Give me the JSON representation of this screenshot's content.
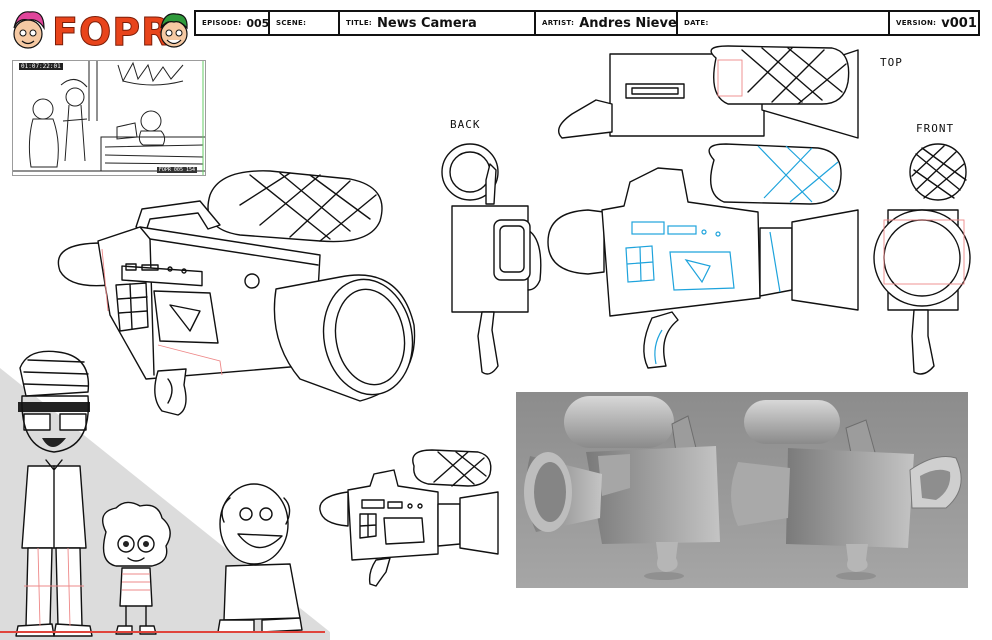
{
  "header": {
    "logo": {
      "wordmark": "FOPR",
      "icon_left": "fairy-character-head-icon",
      "icon_right": "fairy-character-head-icon"
    },
    "fields": [
      {
        "key": "episode",
        "label": "EPISODE:",
        "value": "005"
      },
      {
        "key": "scene",
        "label": "SCENE:",
        "value": ""
      },
      {
        "key": "title",
        "label": "TITLE:",
        "value": "News Camera"
      },
      {
        "key": "artist",
        "label": "ARTIST:",
        "value": "Andres Nieves"
      },
      {
        "key": "date",
        "label": "DATE:",
        "value": ""
      },
      {
        "key": "version",
        "label": "VERSION:",
        "value": "v001"
      }
    ]
  },
  "thumbnail": {
    "timecode": "01:07:22:01",
    "footer_timecode": "FOPR 005 154"
  },
  "views": {
    "top": "TOP",
    "back": "BACK",
    "front": "FRONT"
  },
  "colors": {
    "logo_orange": "#e8441b",
    "construction_red": "#e88888",
    "construction_blue": "#1ea3dc",
    "render_bg": "#9a9a9a",
    "scale_baseline": "#e0453c"
  }
}
